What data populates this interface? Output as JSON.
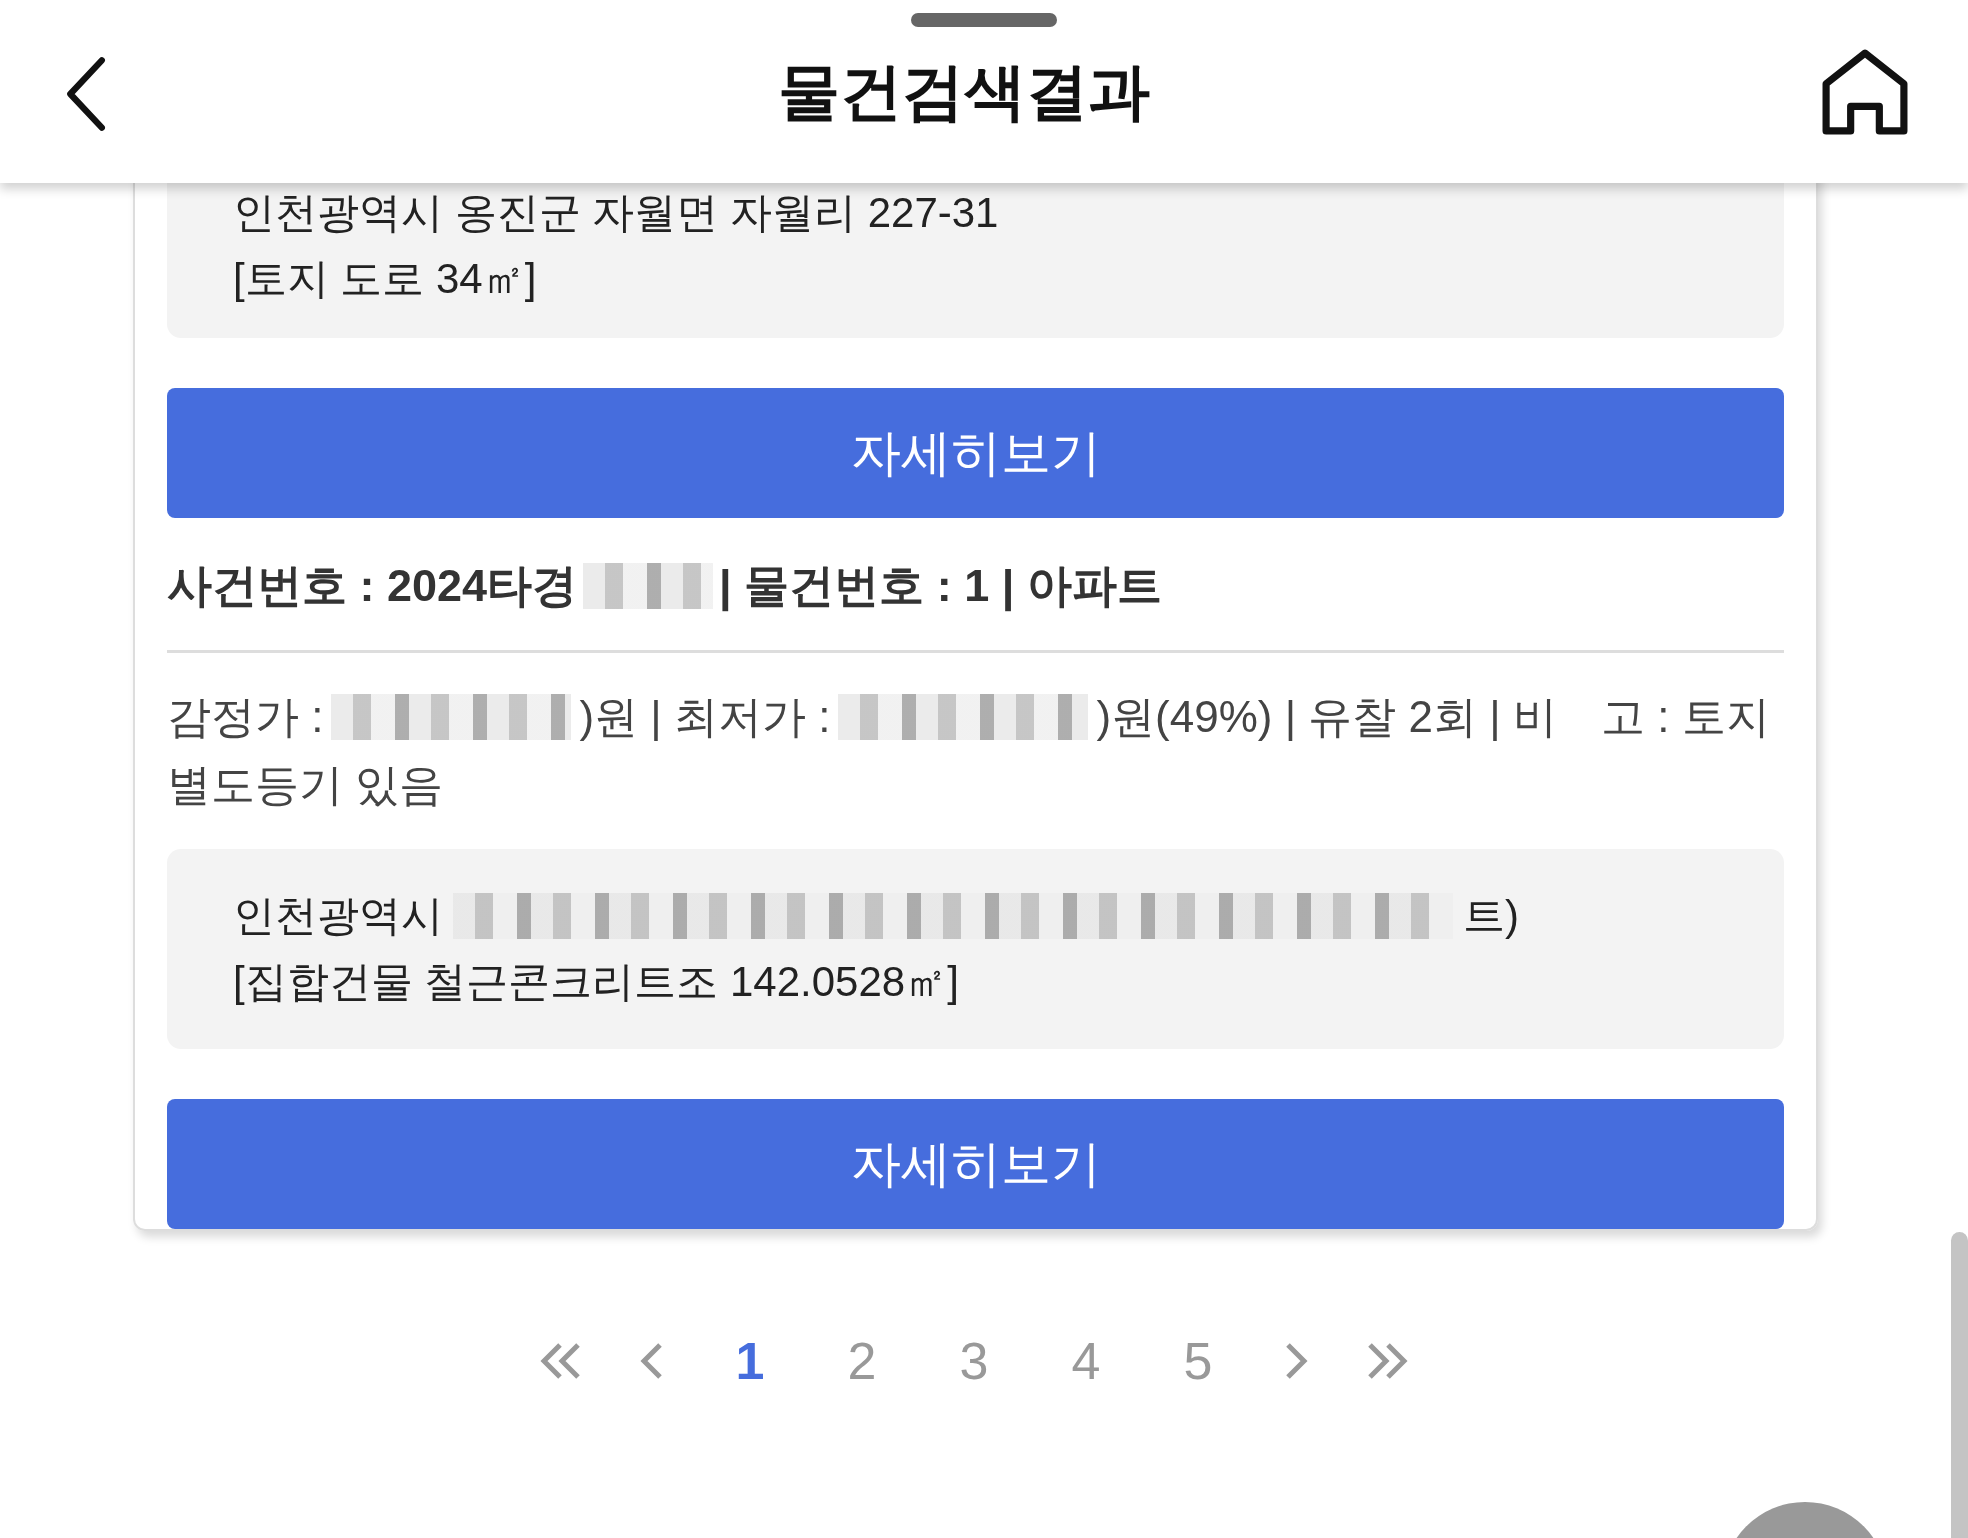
{
  "header": {
    "title": "물건검색결과"
  },
  "items": [
    {
      "address_lines": [
        "인천광역시 옹진군 자월면 자월리 227-31",
        "[토지 도로 34㎡]"
      ],
      "button": "자세히보기"
    },
    {
      "case": [
        {
          "kind": "text",
          "text": "사건번호 : 2024타경"
        },
        {
          "kind": "redacted"
        },
        {
          "kind": "text",
          "text": "| 물건번호 : 1 | 아파트"
        }
      ],
      "info": [
        {
          "kind": "text",
          "text": "감정가 :"
        },
        {
          "kind": "redacted"
        },
        {
          "kind": "text",
          "text": ")원 | 최저가 :"
        },
        {
          "kind": "redacted"
        },
        {
          "kind": "text",
          "text": ")원(49%) | 유찰 2회 | 비　고 : 토지"
        },
        {
          "kind": "text",
          "text": "별도등기 있음"
        }
      ],
      "address": [
        {
          "kind": "text",
          "text": "인천광역시"
        },
        {
          "kind": "redacted"
        },
        {
          "kind": "text",
          "text": "트)"
        }
      ],
      "address_lines": [
        "[집합건물 철근콘크리트조 142.0528㎡]"
      ],
      "button": "자세히보기"
    }
  ],
  "pagination": {
    "pages": [
      {
        "label": "1",
        "selected": true
      },
      {
        "label": "2",
        "selected": false
      },
      {
        "label": "3",
        "selected": false
      },
      {
        "label": "4",
        "selected": false
      },
      {
        "label": "5",
        "selected": false
      }
    ]
  }
}
